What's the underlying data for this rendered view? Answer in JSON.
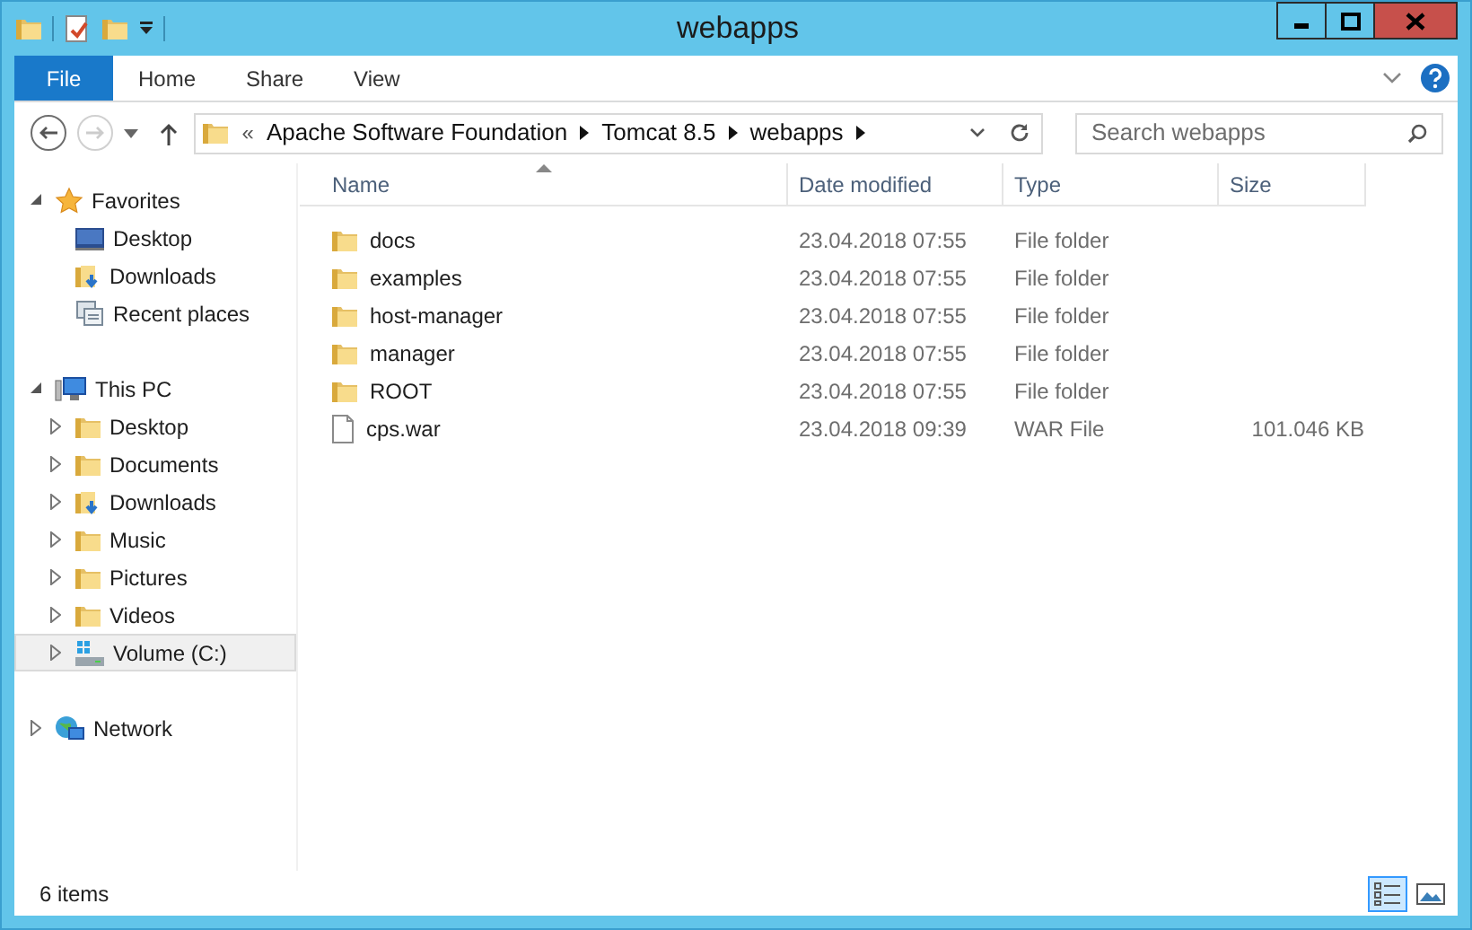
{
  "window": {
    "title": "webapps"
  },
  "ribbon_tabs": [
    {
      "label": "File",
      "kind": "file",
      "selected": false
    },
    {
      "label": "Home",
      "kind": "tab",
      "selected": false
    },
    {
      "label": "Share",
      "kind": "tab",
      "selected": false
    },
    {
      "label": "View",
      "kind": "tab",
      "selected": false
    }
  ],
  "address_bar": {
    "overflow": "«",
    "path": [
      "Apache Software Foundation",
      "Tomcat 8.5",
      "webapps"
    ]
  },
  "search": {
    "placeholder": "Search webapps"
  },
  "navigation": [
    {
      "label": "Favorites",
      "kind": "star",
      "expanded": true,
      "children": [
        {
          "label": "Desktop",
          "kind": "desktop"
        },
        {
          "label": "Downloads",
          "kind": "downloads"
        },
        {
          "label": "Recent places",
          "kind": "recent"
        }
      ]
    },
    {
      "label": "This PC",
      "kind": "pc",
      "expanded": true,
      "children": [
        {
          "label": "Desktop",
          "kind": "folder",
          "expanded": false,
          "selected": false
        },
        {
          "label": "Documents",
          "kind": "folder",
          "expanded": false,
          "selected": false
        },
        {
          "label": "Downloads",
          "kind": "downloads",
          "expanded": false,
          "selected": false
        },
        {
          "label": "Music",
          "kind": "folder",
          "expanded": false,
          "selected": false
        },
        {
          "label": "Pictures",
          "kind": "folder",
          "expanded": false,
          "selected": false
        },
        {
          "label": "Videos",
          "kind": "folder",
          "expanded": false,
          "selected": false
        },
        {
          "label": "Volume (C:)",
          "kind": "drive",
          "expanded": false,
          "selected": true
        }
      ]
    },
    {
      "label": "Network",
      "kind": "network",
      "expanded": false
    }
  ],
  "table": {
    "columns": [
      {
        "label": "Name",
        "sorted": true
      },
      {
        "label": "Date modified",
        "sorted": false
      },
      {
        "label": "Type",
        "sorted": false
      },
      {
        "label": "Size",
        "sorted": false
      }
    ],
    "rows": [
      {
        "kind": "folder",
        "name": "docs",
        "date": "23.04.2018 07:55",
        "type": "File folder"
      },
      {
        "kind": "folder",
        "name": "examples",
        "date": "23.04.2018 07:55",
        "type": "File folder"
      },
      {
        "kind": "folder",
        "name": "host-manager",
        "date": "23.04.2018 07:55",
        "type": "File folder"
      },
      {
        "kind": "folder",
        "name": "manager",
        "date": "23.04.2018 07:55",
        "type": "File folder"
      },
      {
        "kind": "folder",
        "name": "ROOT",
        "date": "23.04.2018 07:55",
        "type": "File folder"
      },
      {
        "kind": "file",
        "name": "cps.war",
        "date": "23.04.2018 09:39",
        "type": "WAR File",
        "size": "101.046 KB"
      }
    ]
  },
  "status_bar": {
    "text": "6 items"
  },
  "view_buttons": [
    {
      "kind": "details",
      "selected": true
    },
    {
      "kind": "large",
      "selected": false
    }
  ]
}
